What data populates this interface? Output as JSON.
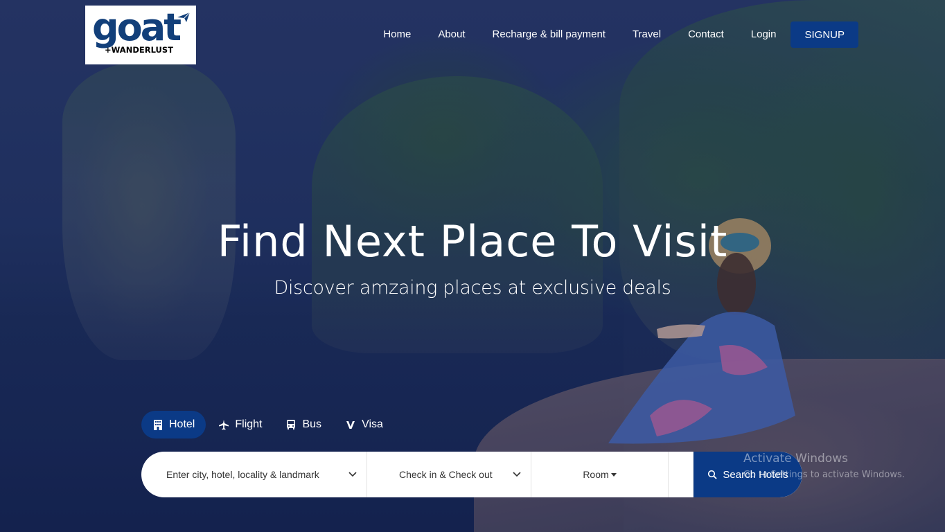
{
  "brand": {
    "logo_main": "goat",
    "logo_sub": "+WANDERLUST",
    "logo_color": "#123f7a"
  },
  "nav": {
    "items": [
      "Home",
      "About",
      "Recharge & bill payment",
      "Travel",
      "Contact",
      "Login"
    ],
    "signup_label": "SIGNUP"
  },
  "hero": {
    "title": "Find Next Place To Visit",
    "subtitle": "Discover amzaing places at exclusive deals"
  },
  "tabs": [
    {
      "label": "Hotel",
      "icon": "hotel-icon",
      "active": true
    },
    {
      "label": "Flight",
      "icon": "plane-icon",
      "active": false
    },
    {
      "label": "Bus",
      "icon": "bus-icon",
      "active": false
    },
    {
      "label": "Visa",
      "icon": "visa-icon",
      "active": false
    }
  ],
  "search": {
    "destination_placeholder": "Enter city, hotel, locality & landmark",
    "dates_label": "Check in & Check out",
    "room_label": "Room",
    "button_label": "Search Hotels"
  },
  "watermark": {
    "title": "Activate Windows",
    "subtitle": "Go to Settings to activate Windows."
  },
  "colors": {
    "accent": "#0b3a86",
    "overlay": "#1c2a52"
  }
}
